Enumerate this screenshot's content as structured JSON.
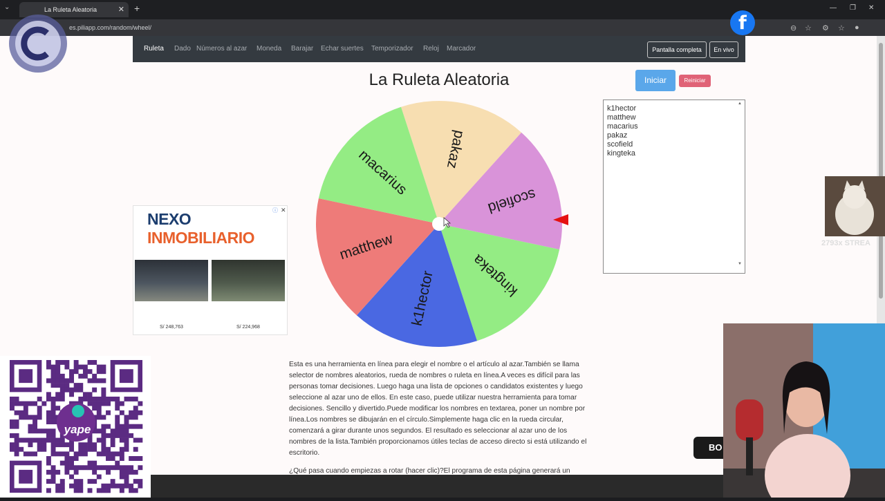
{
  "browser": {
    "tab_title": "La Ruleta Aleatoria",
    "url": "es.piliapp.com/random/wheel/"
  },
  "nav": {
    "items": [
      "Ruleta",
      "Dado",
      "Números al azar",
      "Moneda",
      "Barajar",
      "Echar suertes",
      "Temporizador",
      "Reloj",
      "Marcador"
    ],
    "fullscreen": "Pantalla completa",
    "live": "En vivo"
  },
  "page": {
    "title": "La Ruleta Aleatoria",
    "start_button": "Iniciar",
    "reset_button": "Reiniciar"
  },
  "names_list": [
    "k1hector",
    "matthew",
    "macarius",
    "pakaz",
    "scofield",
    "kingteka"
  ],
  "wheel": {
    "segments": [
      {
        "name": "pakaz",
        "color": "#f7deb1"
      },
      {
        "name": "scofield",
        "color": "#d993d9"
      },
      {
        "name": "kingteka",
        "color": "#94ec84"
      },
      {
        "name": "k1hector",
        "color": "#4a68e2"
      },
      {
        "name": "matthew",
        "color": "#ee7b79"
      },
      {
        "name": "macarius",
        "color": "#94ec84"
      }
    ],
    "pointer_color": "#e51111"
  },
  "ad": {
    "brand_a": "NEXO",
    "brand_b": " INMOBILIARIO",
    "price_left": "S/ 248,763",
    "price_right": "S/ 224,968"
  },
  "description": "Esta es una herramienta en línea para elegir el nombre o el artículo al azar.También se llama selector de nombres aleatorios, rueda de nombres o ruleta en línea.A veces es difícil para las personas tomar decisiones. Luego haga una lista de opciones o candidatos existentes y luego seleccione al azar uno de ellos. En este caso, puede utilizar nuestra herramienta para tomar decisiones. Sencillo y divertido.Puede modificar los nombres en textarea, poner un nombre por línea.Los nombres se dibujarán en el círculo.Simplemente haga clic en la rueda circular, comenzará a girar durante unos segundos. El resultado es seleccionar al azar uno de los nombres de la lista.También proporcionamos útiles teclas de acceso directo si está utilizando el escritorio.",
  "description2": "¿Qué pasa cuando empiezas a rotar (hacer clic)?El programa de esta página generará un",
  "overlay": {
    "streak": "2793x STREA",
    "yape": "yape",
    "bc": "BO"
  }
}
